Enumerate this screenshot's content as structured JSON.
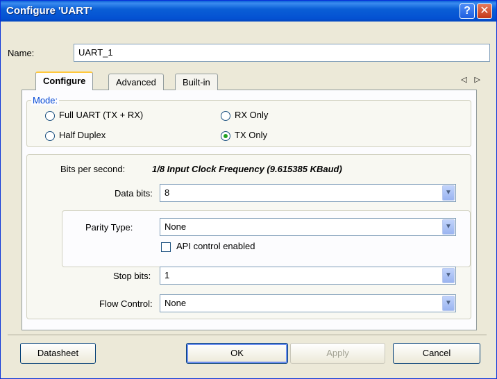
{
  "window": {
    "title": "Configure 'UART'",
    "help_glyph": "?",
    "close_glyph": "✕"
  },
  "name": {
    "label": "Name:",
    "value": "UART_1"
  },
  "tabs": [
    {
      "label": "Configure",
      "active": true
    },
    {
      "label": "Advanced",
      "active": false
    },
    {
      "label": "Built-in",
      "active": false
    }
  ],
  "tab_scroll": "◁ ▷",
  "mode": {
    "title": "Mode:",
    "options": [
      {
        "label": "Full UART (TX + RX)",
        "selected": false
      },
      {
        "label": "Half Duplex",
        "selected": false
      },
      {
        "label": "RX Only",
        "selected": false
      },
      {
        "label": "TX Only",
        "selected": true
      }
    ]
  },
  "settings": {
    "bits_per_second_label": "Bits per second:",
    "bits_per_second_value": "1/8 Input Clock Frequency (9.615385 KBaud)",
    "data_bits_label": "Data bits:",
    "data_bits_value": "8",
    "parity_type_label": "Parity Type:",
    "parity_type_value": "None",
    "api_control_label": "API control enabled",
    "api_control_checked": false,
    "stop_bits_label": "Stop bits:",
    "stop_bits_value": "1",
    "flow_control_label": "Flow Control:",
    "flow_control_value": "None"
  },
  "buttons": {
    "datasheet": "Datasheet",
    "ok": "OK",
    "apply": "Apply",
    "cancel": "Cancel"
  },
  "dropdown_glyph": "▼"
}
